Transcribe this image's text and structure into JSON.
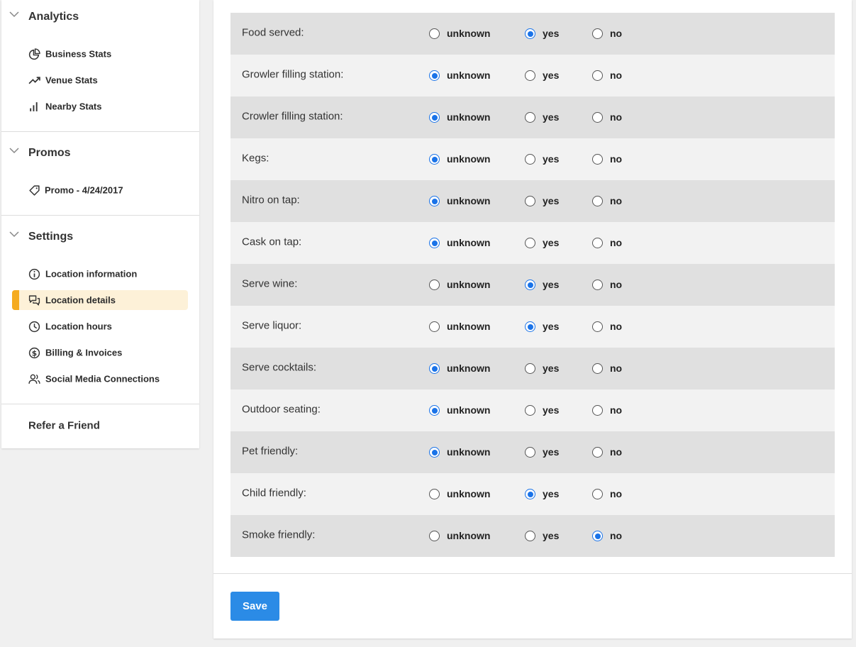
{
  "sidebar": {
    "sections": [
      {
        "title": "Analytics",
        "items": [
          {
            "label": "Business Stats",
            "icon": "pie-chart-icon"
          },
          {
            "label": "Venue Stats",
            "icon": "trending-up-icon"
          },
          {
            "label": "Nearby Stats",
            "icon": "bar-chart-icon"
          }
        ]
      },
      {
        "title": "Promos",
        "items": [
          {
            "label": "Promo - 4/24/2017",
            "icon": "tag-icon"
          }
        ]
      },
      {
        "title": "Settings",
        "items": [
          {
            "label": "Location information",
            "icon": "info-icon"
          },
          {
            "label": "Location details",
            "icon": "chat-icon",
            "active": true
          },
          {
            "label": "Location hours",
            "icon": "clock-icon"
          },
          {
            "label": "Billing & Invoices",
            "icon": "dollar-icon"
          },
          {
            "label": "Social Media Connections",
            "icon": "users-icon"
          }
        ]
      }
    ],
    "refer_label": "Refer a Friend",
    "accent_color": "#f5ab20",
    "active_bg": "#fdf1d8"
  },
  "options": [
    "unknown",
    "yes",
    "no"
  ],
  "rows": [
    {
      "label": "Food served:",
      "selected": "yes"
    },
    {
      "label": "Growler filling station:",
      "selected": "unknown"
    },
    {
      "label": "Crowler filling station:",
      "selected": "unknown"
    },
    {
      "label": "Kegs:",
      "selected": "unknown"
    },
    {
      "label": "Nitro on tap:",
      "selected": "unknown"
    },
    {
      "label": "Cask on tap:",
      "selected": "unknown"
    },
    {
      "label": "Serve wine:",
      "selected": "yes"
    },
    {
      "label": "Serve liquor:",
      "selected": "yes"
    },
    {
      "label": "Serve cocktails:",
      "selected": "unknown"
    },
    {
      "label": "Outdoor seating:",
      "selected": "unknown"
    },
    {
      "label": "Pet friendly:",
      "selected": "unknown"
    },
    {
      "label": "Child friendly:",
      "selected": "yes"
    },
    {
      "label": "Smoke friendly:",
      "selected": "no"
    }
  ],
  "save_label": "Save",
  "radio_color": "#1a73e8",
  "button_color": "#2b8be6"
}
